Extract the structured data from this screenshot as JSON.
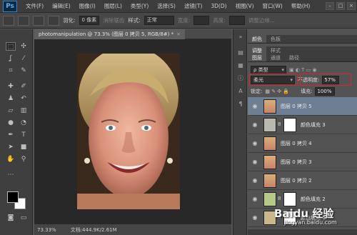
{
  "app": {
    "logo": "Ps"
  },
  "menu": [
    "文件(F)",
    "编辑(E)",
    "图像(I)",
    "图层(L)",
    "类型(Y)",
    "选择(S)",
    "滤镜(T)",
    "3D(D)",
    "视图(V)",
    "窗口(W)",
    "帮助(H)"
  ],
  "window_controls": [
    "–",
    "□",
    "×"
  ],
  "options": {
    "feather_label": "羽化:",
    "feather_value": "0 像素",
    "antialias_label": "消除锯齿",
    "style_label": "样式:",
    "style_value": "正常",
    "width_label": "宽度:",
    "height_label": "高度:",
    "refine_label": "调整边缘..."
  },
  "document": {
    "tab_title": "photomanipulation @ 73.3% (图层 0 拷贝 5, RGB/8#) *",
    "zoom": "73.33%",
    "doc_info": "文档:444.9K/2.61M"
  },
  "panels": {
    "top_tabs": [
      "颜色",
      "色板"
    ],
    "mid_tabs": [
      "调整",
      "样式"
    ],
    "layer_tabs": [
      "图层",
      "通道",
      "路径"
    ],
    "filter_kind": "ρ 类型",
    "blend_mode": "柔光",
    "opacity_label": "不透明度:",
    "opacity_value": "57%",
    "lock_label": "锁定:",
    "fill_label": "填充:",
    "fill_value": "100%"
  },
  "layers": [
    {
      "name": "图层 0 拷贝 5",
      "type": "photo",
      "selected": true
    },
    {
      "name": "颜色填充 3",
      "type": "fill",
      "fill_color": "#b9b9ad"
    },
    {
      "name": "图层 0 拷贝 4",
      "type": "photo"
    },
    {
      "name": "图层 0 拷贝 3",
      "type": "photo"
    },
    {
      "name": "图层 0 拷贝 2",
      "type": "photo"
    },
    {
      "name": "颜色填充 2",
      "type": "fill",
      "fill_color": "#b7c98a"
    },
    {
      "name": "颜色填充 1",
      "type": "fill",
      "fill_color": "#c9b98a"
    }
  ],
  "watermark": {
    "text": "Baidu 经验",
    "url": "jingyan.baidu.com"
  },
  "colors": {
    "highlight": "#e0202a",
    "selected_layer": "#6e7e93"
  }
}
